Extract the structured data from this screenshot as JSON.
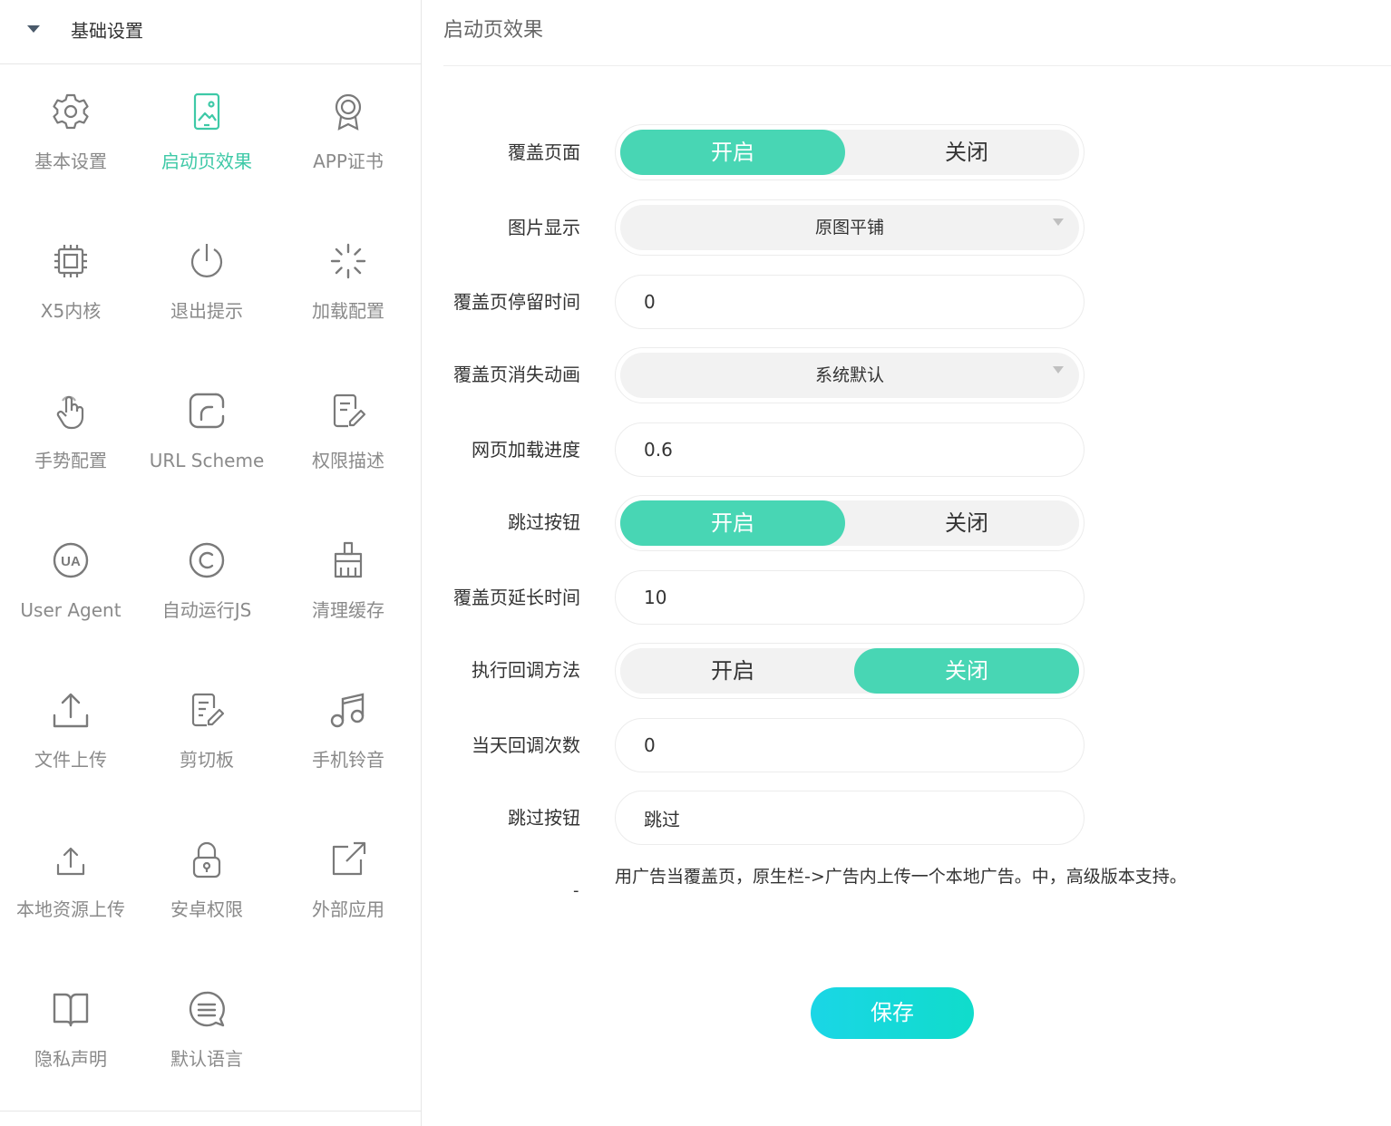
{
  "sidebar": {
    "header_title": "基础设置",
    "items": [
      {
        "label": "基本设置",
        "icon": "gear-icon",
        "active": false
      },
      {
        "label": "启动页效果",
        "icon": "phone-image-icon",
        "active": true
      },
      {
        "label": "APP证书",
        "icon": "badge-icon",
        "active": false
      },
      {
        "label": "X5内核",
        "icon": "chip-icon",
        "active": false
      },
      {
        "label": "退出提示",
        "icon": "power-icon",
        "active": false
      },
      {
        "label": "加载配置",
        "icon": "spinner-icon",
        "active": false
      },
      {
        "label": "手势配置",
        "icon": "hand-pointer-icon",
        "active": false
      },
      {
        "label": "URL Scheme",
        "icon": "scheme-icon",
        "active": false
      },
      {
        "label": "权限描述",
        "icon": "document-edit-icon",
        "active": false
      },
      {
        "label": "User Agent",
        "icon": "ua-icon",
        "active": false
      },
      {
        "label": "自动运行JS",
        "icon": "copyright-icon",
        "active": false
      },
      {
        "label": "清理缓存",
        "icon": "brush-icon",
        "active": false
      },
      {
        "label": "文件上传",
        "icon": "upload-icon",
        "active": false
      },
      {
        "label": "剪切板",
        "icon": "clipboard-edit-icon",
        "active": false
      },
      {
        "label": "手机铃音",
        "icon": "music-note-icon",
        "active": false
      },
      {
        "label": "本地资源上传",
        "icon": "upload-small-icon",
        "active": false
      },
      {
        "label": "安卓权限",
        "icon": "lock-icon",
        "active": false
      },
      {
        "label": "外部应用",
        "icon": "external-link-icon",
        "active": false
      },
      {
        "label": "隐私声明",
        "icon": "book-icon",
        "active": false
      },
      {
        "label": "默认语言",
        "icon": "chat-lines-icon",
        "active": false
      }
    ]
  },
  "main": {
    "title": "启动页效果",
    "rows": {
      "cover_page": {
        "label": "覆盖页面",
        "on_label": "开启",
        "off_label": "关闭",
        "value": "on"
      },
      "image_display": {
        "label": "图片显示",
        "value": "原图平铺"
      },
      "stay_time": {
        "label": "覆盖页停留时间",
        "value": "0"
      },
      "disappear_anim": {
        "label": "覆盖页消失动画",
        "value": "系统默认"
      },
      "load_progress": {
        "label": "网页加载进度",
        "value": "0.6"
      },
      "skip_button": {
        "label": "跳过按钮",
        "on_label": "开启",
        "off_label": "关闭",
        "value": "on"
      },
      "extend_time": {
        "label": "覆盖页延长时间",
        "value": "10"
      },
      "callback": {
        "label": "执行回调方法",
        "on_label": "开启",
        "off_label": "关闭",
        "value": "off"
      },
      "daily_callbacks": {
        "label": "当天回调次数",
        "value": "0"
      },
      "skip_text": {
        "label": "跳过按钮",
        "value": "跳过"
      }
    },
    "note_dash": "-",
    "note": "用广告当覆盖页，原生栏->广告内上传一个本地广告。中，高级版本支持。",
    "save_label": "保存"
  },
  "colors": {
    "accent": "#48d6b4",
    "active_text": "#3ec9a7",
    "save_gradient_start": "#1ad6e6",
    "save_gradient_end": "#10dccb"
  }
}
